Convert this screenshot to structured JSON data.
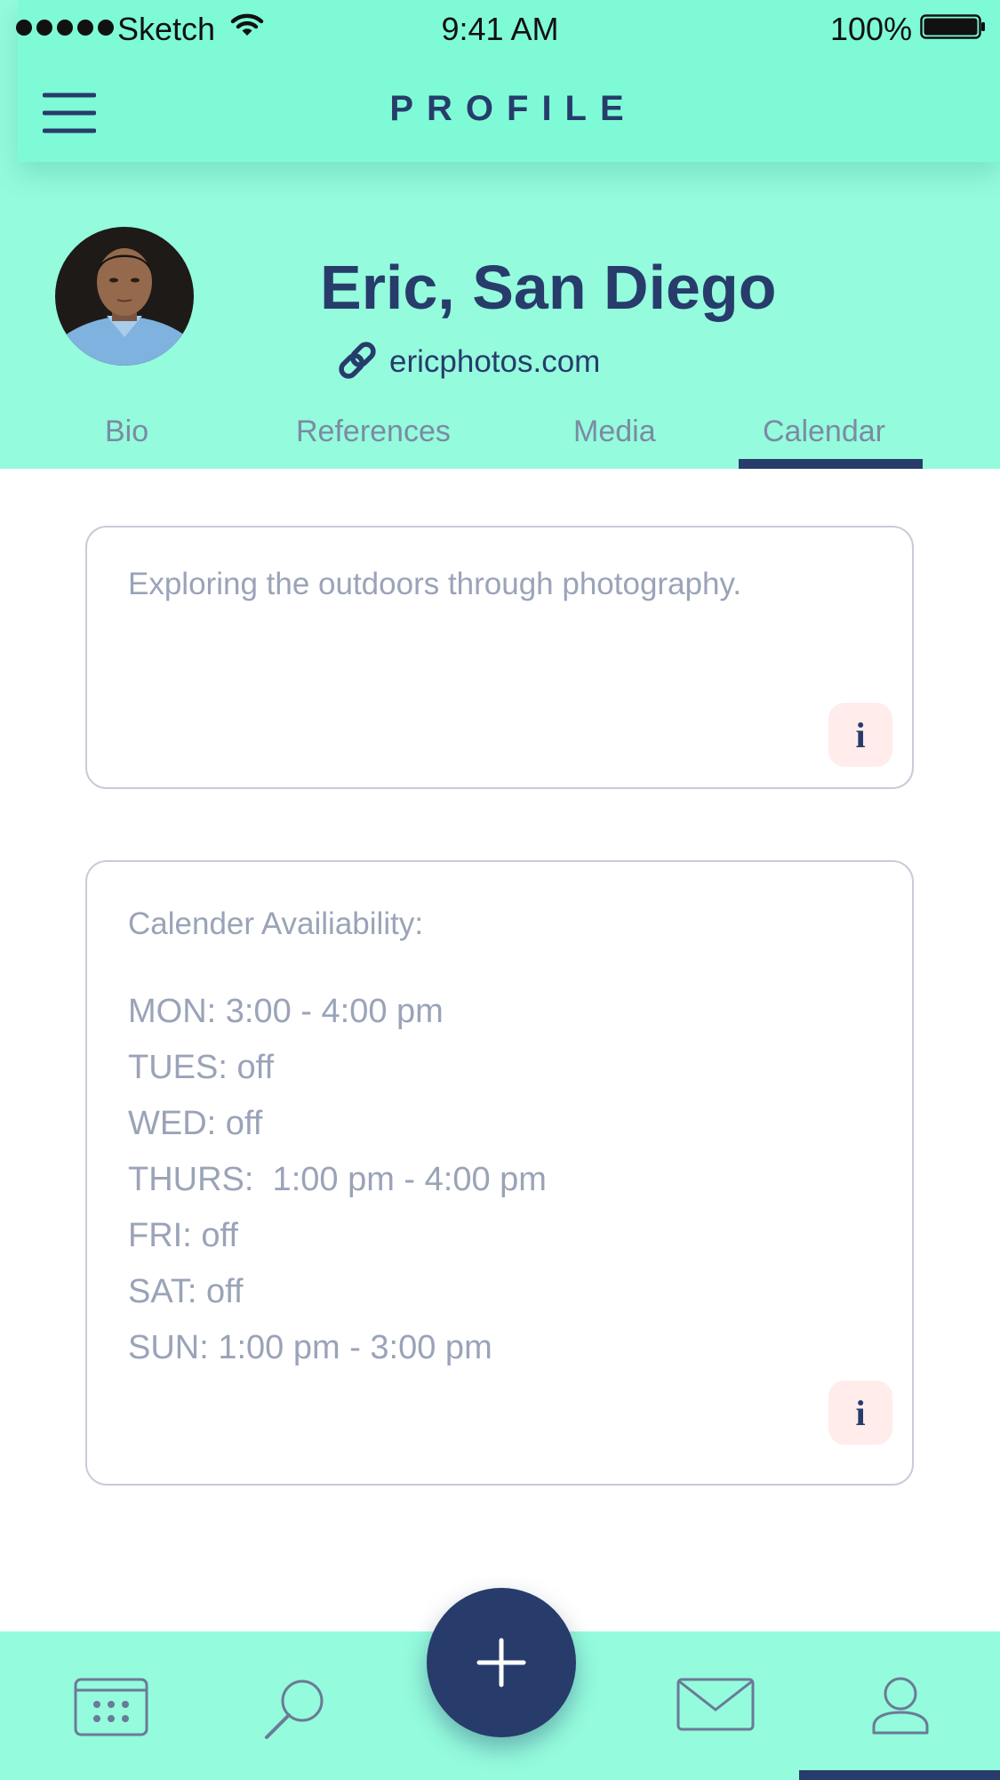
{
  "status_bar": {
    "carrier": "Sketch",
    "time": "9:41 AM",
    "battery": "100%"
  },
  "header": {
    "title": "PROFILE"
  },
  "profile": {
    "name": "Eric, San Diego",
    "website": "ericphotos.com"
  },
  "tabs": [
    {
      "label": "Bio",
      "active": false
    },
    {
      "label": "References",
      "active": false
    },
    {
      "label": "Media",
      "active": false
    },
    {
      "label": "Calendar",
      "active": true
    }
  ],
  "bio_card": {
    "text": "Exploring the outdoors through photography.",
    "info_label": "i"
  },
  "calendar_card": {
    "title": "Calender Availiability:",
    "availability": [
      "MON: 3:00 - 4:00 pm",
      "TUES: off",
      "WED: off",
      "THURS:  1:00 pm - 4:00 pm",
      "FRI: off",
      "SAT: off",
      "SUN: 1:00 pm - 3:00 pm"
    ],
    "info_label": "i"
  },
  "tab_bar": {
    "items": [
      "calendar-icon",
      "search-icon",
      "add-icon",
      "mail-icon",
      "profile-icon"
    ],
    "active": "profile-icon"
  },
  "colors": {
    "accent": "#94fbdd",
    "nav": "#7efbd6",
    "primary": "#273c6b",
    "muted_text": "#9aa3b8",
    "info_bg": "#ffeceb"
  }
}
